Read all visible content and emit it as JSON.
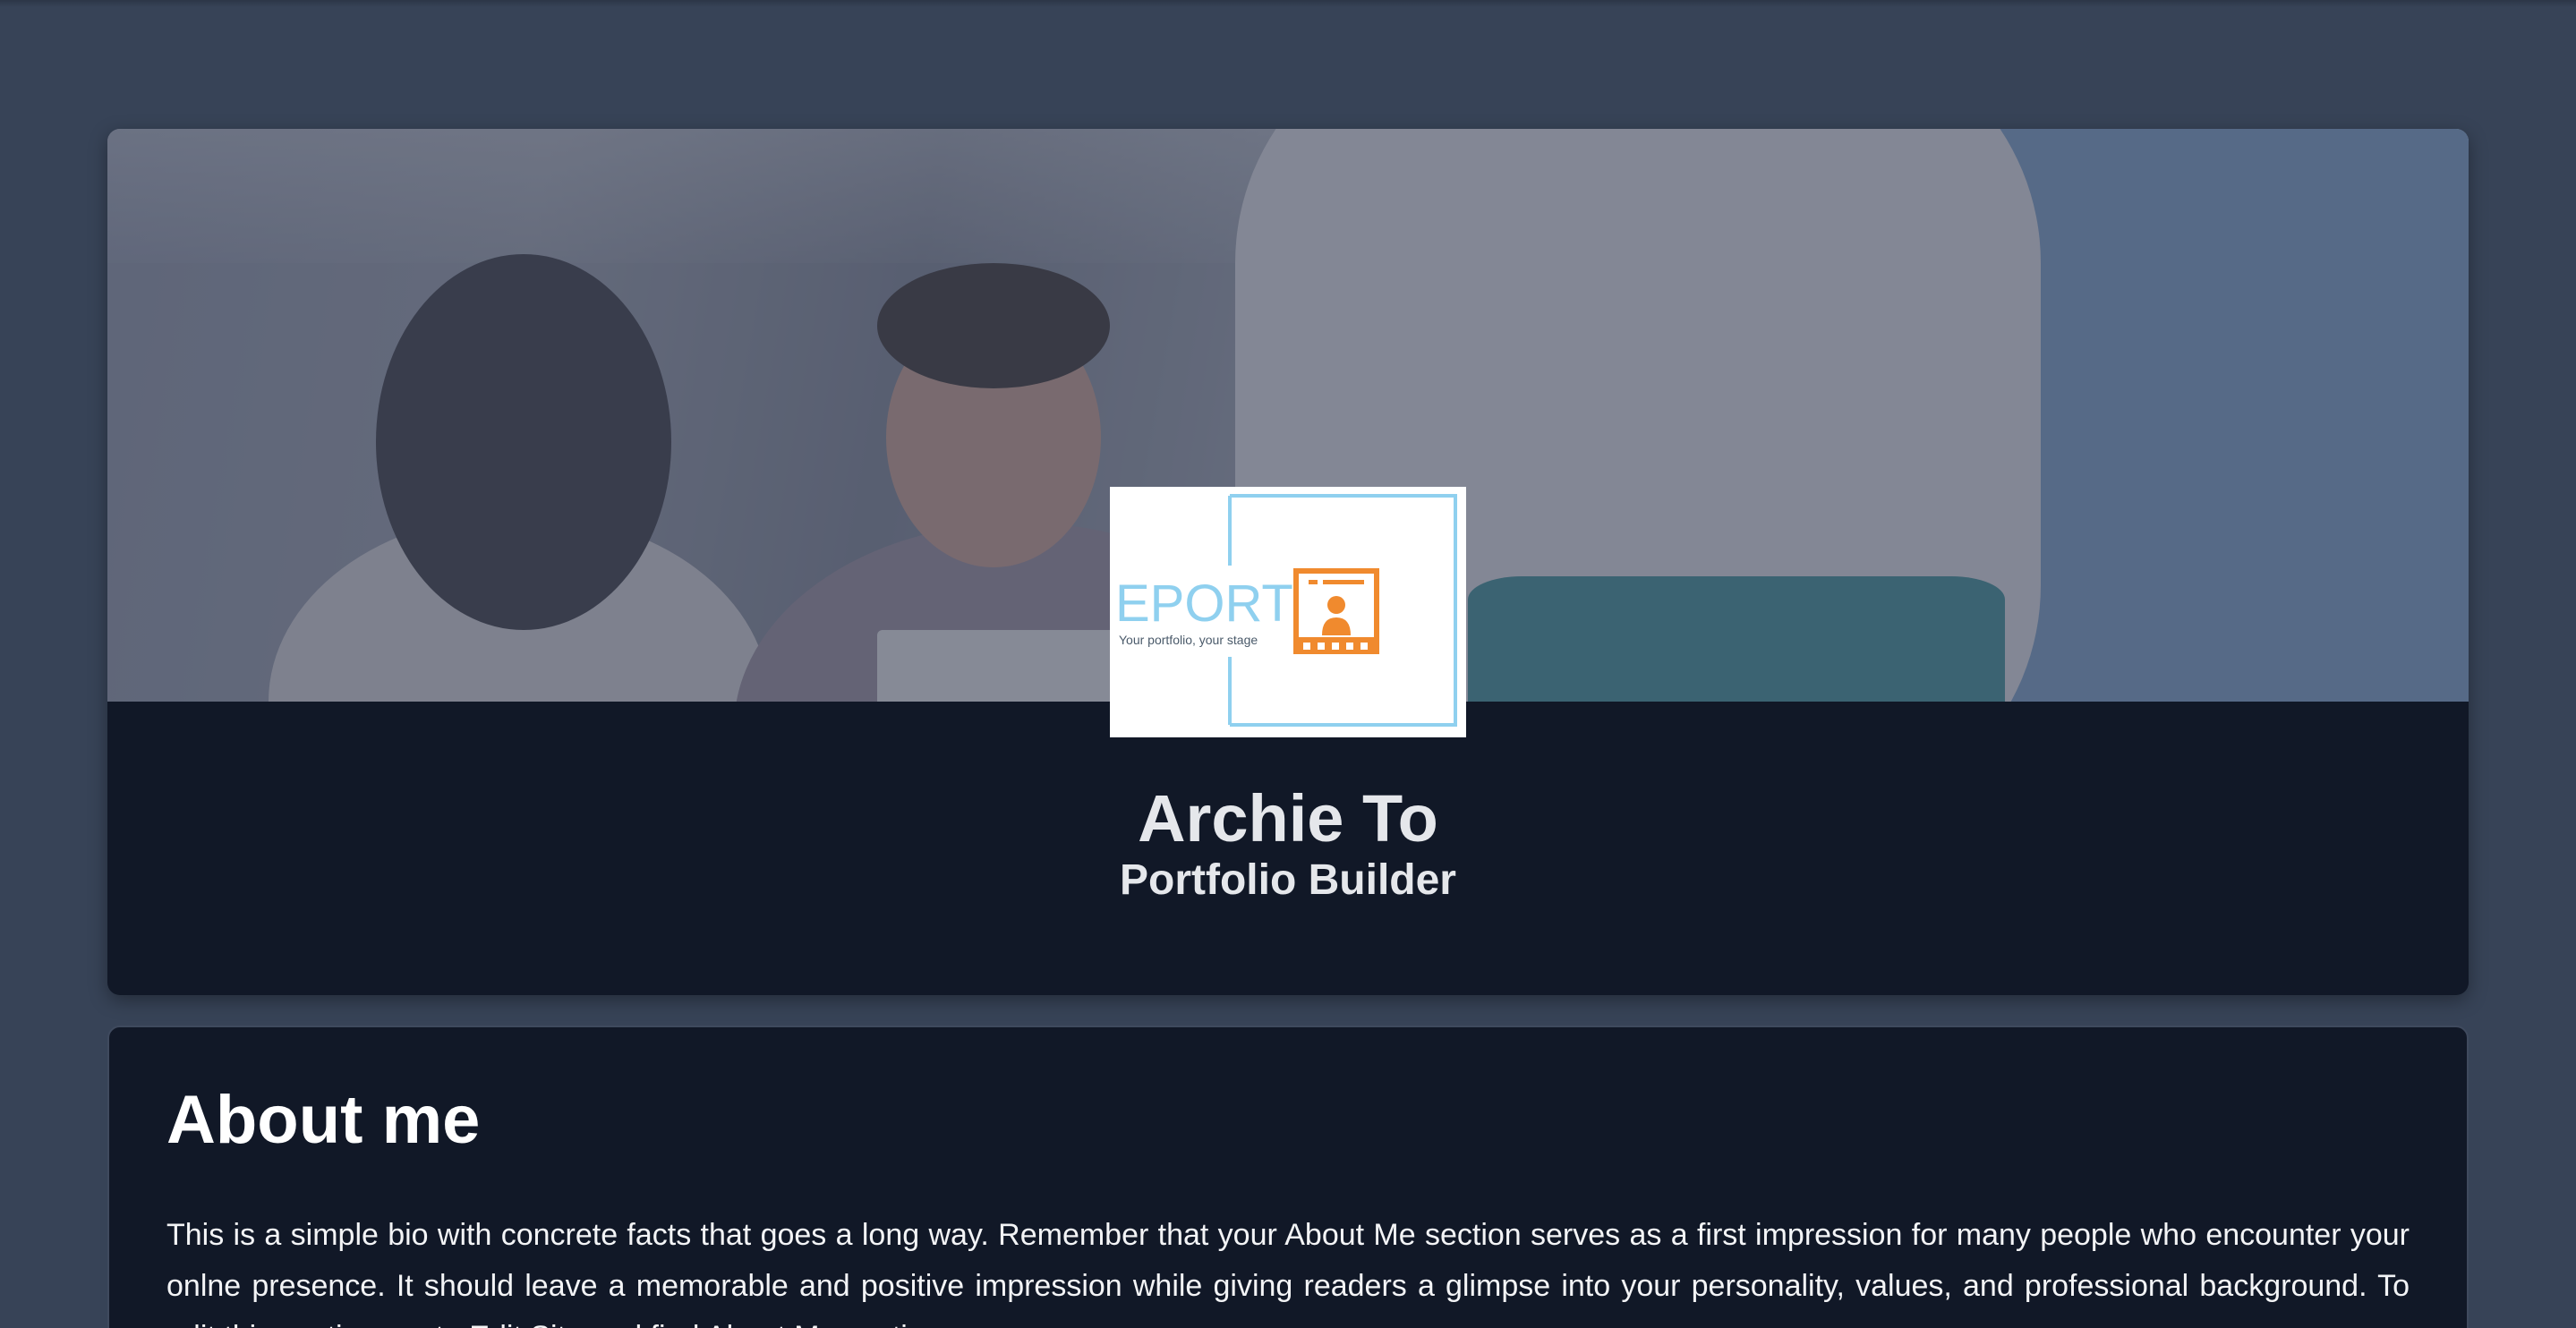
{
  "profile": {
    "logo": {
      "wordmark": "EPORT",
      "tagline": "Your portfolio, your stage",
      "icon": "portfolio-person-icon",
      "colors": {
        "wordmark": "#8fd0ef",
        "accent": "#f08a2e",
        "frame": "#8fd0ef"
      }
    },
    "name": "Archie To",
    "title": "Portfolio Builder"
  },
  "about": {
    "heading": "About me",
    "body": "This is a simple bio with concrete facts that goes a long way. Remember that your About Me section serves as a first impression for many people who encounter your onlne presence. It should leave a memorable and positive impression while giving readers a glimpse into your personality, values, and professional background. To edit this section, go to Edit Site and find About Me section."
  },
  "colors": {
    "page_background": "#374357",
    "card_background": "#111827",
    "heading_text": "#e5e7eb"
  }
}
